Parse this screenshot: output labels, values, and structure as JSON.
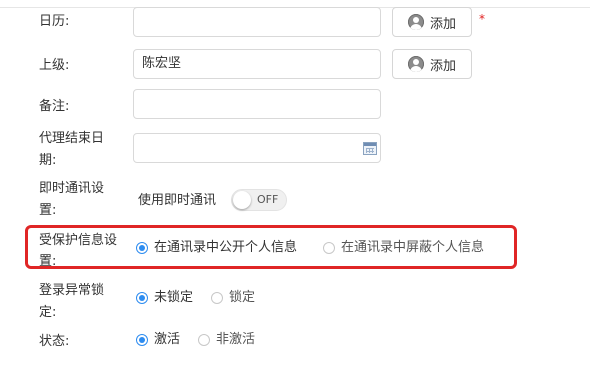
{
  "form": {
    "calendar": {
      "label": "日历:",
      "value": "",
      "button_label": "添加",
      "required_mark": "*"
    },
    "superior": {
      "label": "上级:",
      "value": "陈宏坚",
      "button_label": "添加"
    },
    "remark": {
      "label": "备注:",
      "value": ""
    },
    "agent_end_date": {
      "label_line1": "代理结束日",
      "label_line2": "期:",
      "value": ""
    },
    "im_settings": {
      "label_line1": "即时通讯设",
      "label_line2": "置:",
      "text": "使用即时通讯",
      "toggle_label": "OFF"
    },
    "protected_info": {
      "label_line1": "受保护信息设",
      "label_line2": "置:",
      "options": [
        "在通讯录中公开个人信息",
        "在通讯录中屏蔽个人信息"
      ],
      "selected": 0
    },
    "login_lock": {
      "label_line1": "登录异常锁",
      "label_line2": "定:",
      "options": [
        "未锁定",
        "锁定"
      ],
      "selected": 0
    },
    "status": {
      "label": "状态:",
      "options": [
        "激活",
        "非激活"
      ],
      "selected": 0
    }
  },
  "colors": {
    "accent": "#2d8cf0",
    "highlight": "#e02626",
    "required": "#e02020"
  }
}
